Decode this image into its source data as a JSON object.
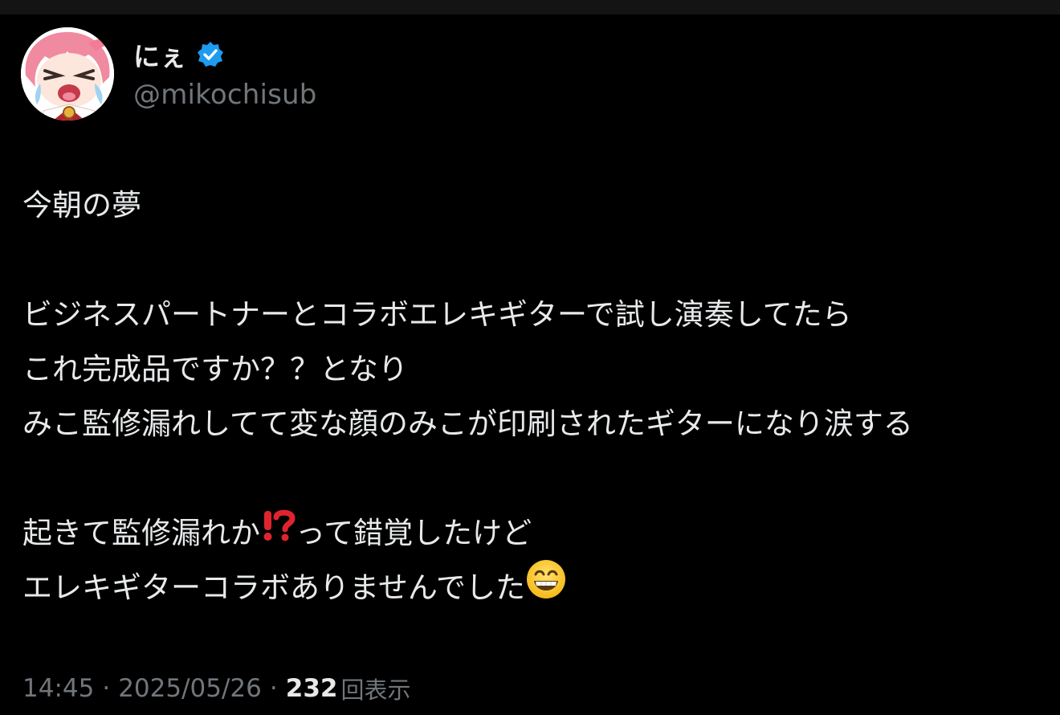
{
  "tweet": {
    "author": {
      "display_name": "にぇ",
      "handle": "@mikochisub",
      "avatar_icon": "avatar-anime-girl-crying",
      "verified_icon": "verified-badge-icon",
      "verified_color": "#1d9bf0"
    },
    "body": {
      "line1": "今朝の夢",
      "line2": "ビジネスパートナーとコラボエレキギターで試し演奏してたら",
      "line3": "これ完成品ですか？？となり",
      "line4": "みこ監修漏れしてて変な顔のみこが印刷されたギターになり涙する",
      "line5_before": "起きて監修漏れか",
      "line5_emoji": "exclamation-question-mark-icon",
      "line5_after": "って錯覚したけど",
      "line6": "エレキギターコラボありませんでした",
      "line6_emoji": "grinning-face-with-smiling-eyes-icon"
    },
    "meta": {
      "time": "14:45",
      "separator": "·",
      "date": "2025/05/26",
      "views_count": "232",
      "views_label": "回表示"
    }
  },
  "colors": {
    "background": "#000000",
    "text_primary": "#e7e9ea",
    "text_secondary": "#71767b",
    "accent": "#1d9bf0"
  }
}
